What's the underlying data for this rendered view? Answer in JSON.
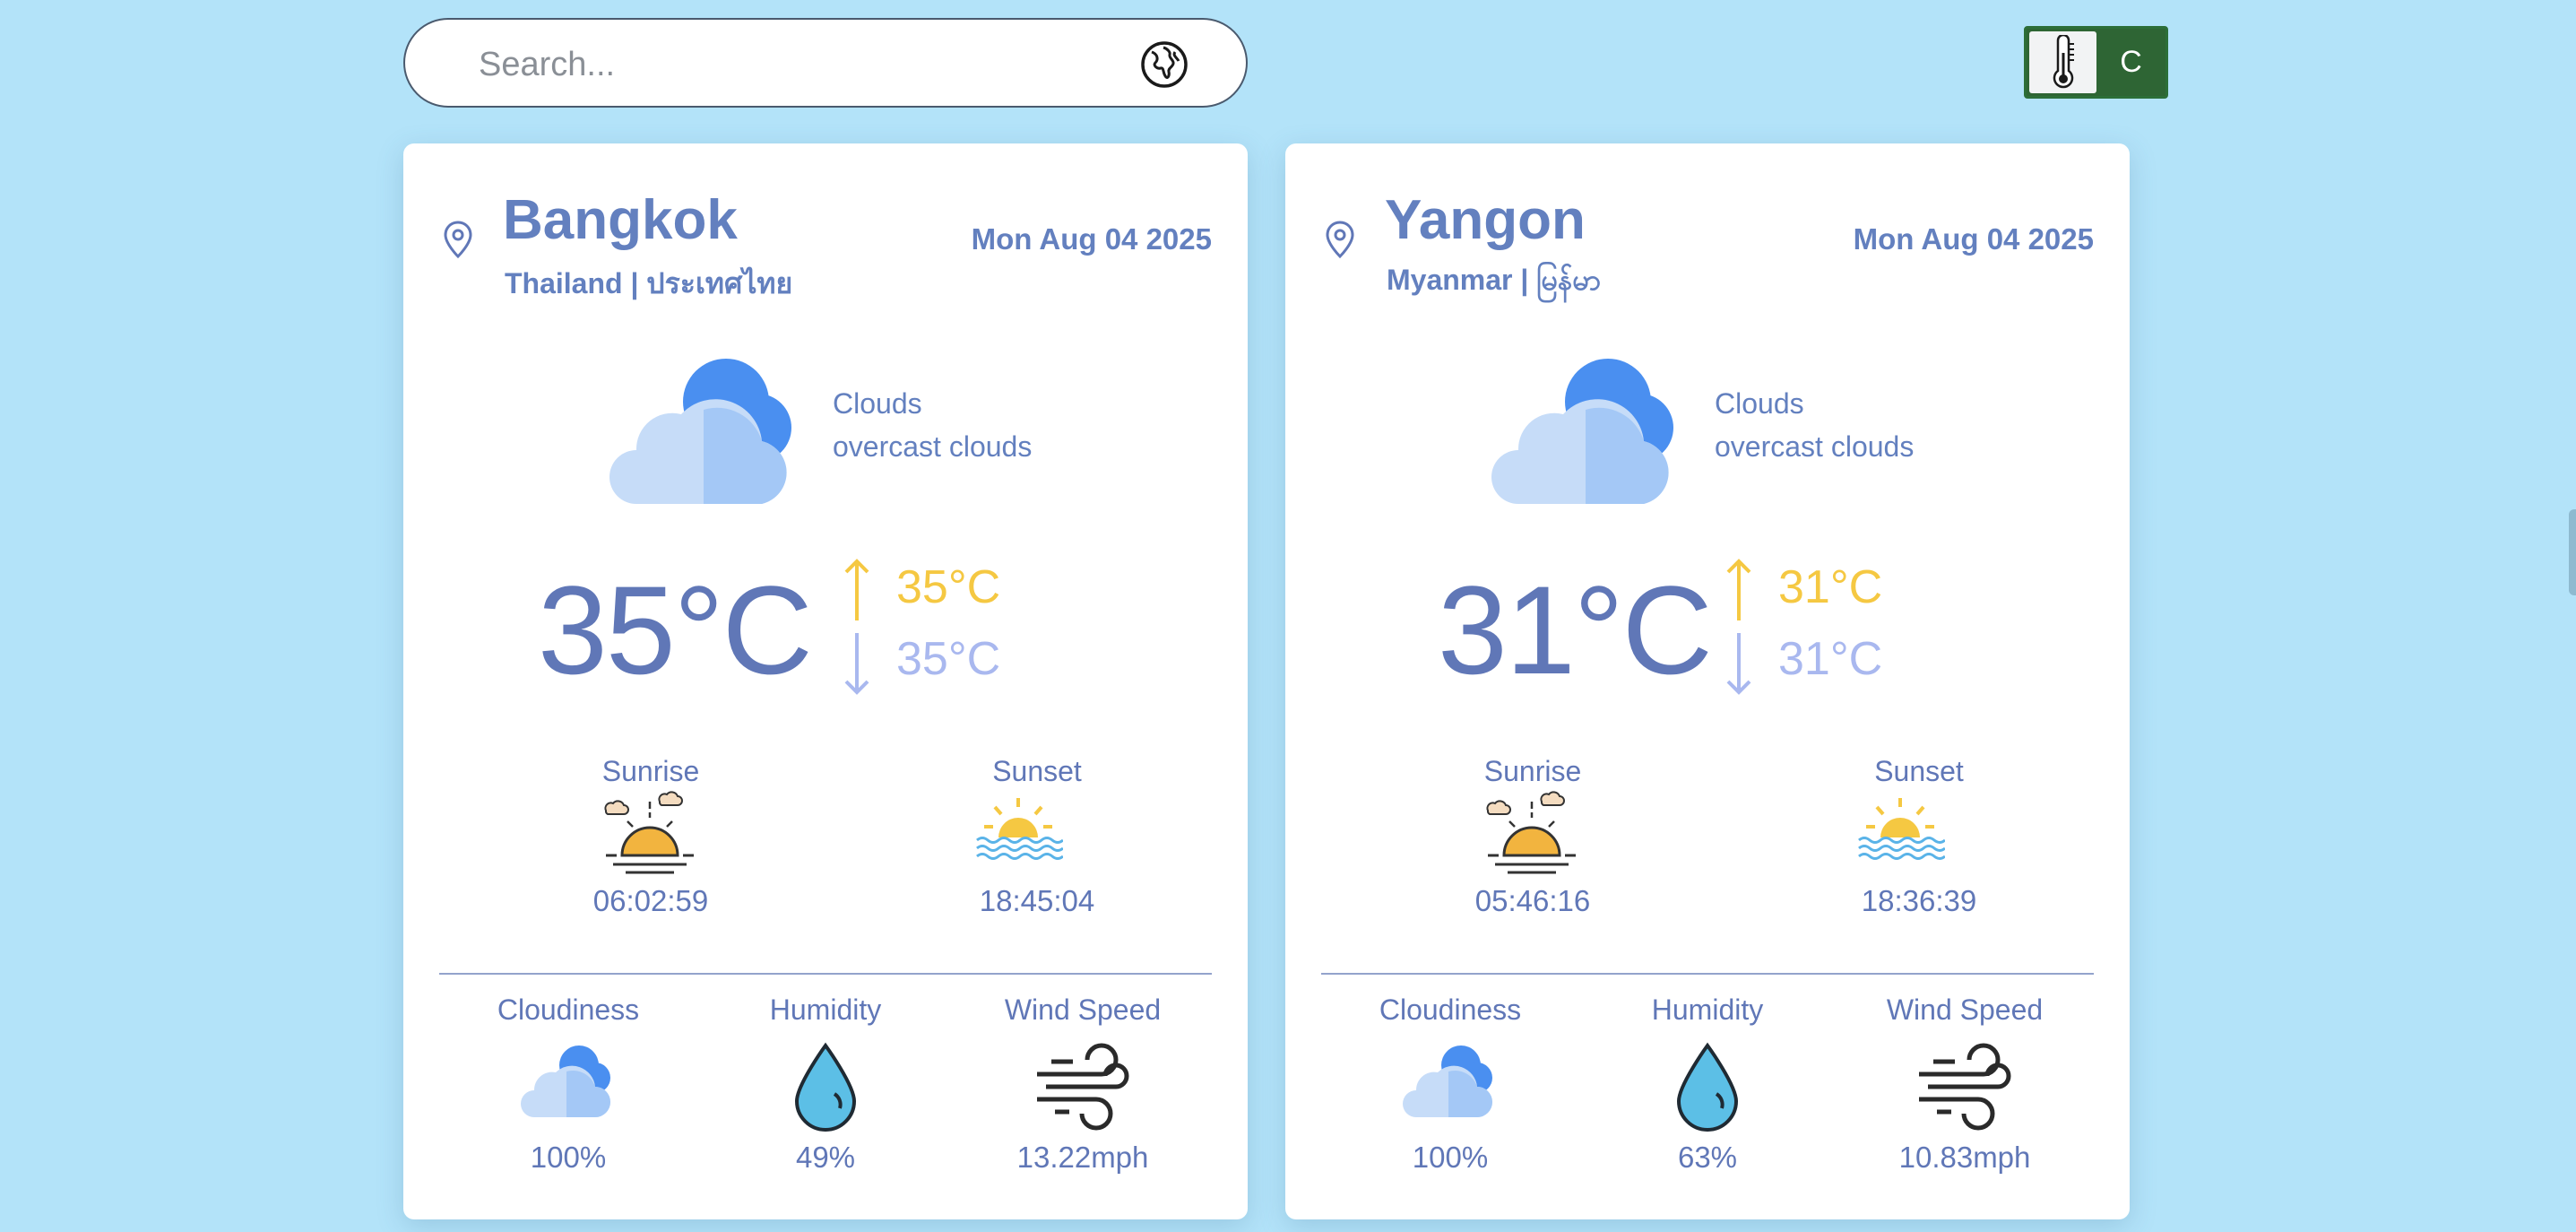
{
  "search": {
    "placeholder": "Search..."
  },
  "icons": {
    "globe": "globe-icon",
    "thermometer": "thermometer-icon",
    "location": "location-pin-icon",
    "clouds": "clouds-icon",
    "sunrise": "sunrise-icon",
    "sunset": "sunset-icon",
    "humidity": "water-drop-icon",
    "wind": "wind-icon"
  },
  "unit_toggle": {
    "value": "C"
  },
  "colors": {
    "background": "#b3e3f9",
    "text": "#6077b7",
    "temp_max": "#f5c842",
    "temp_min": "#a9b8ef",
    "toggle": "#2e6534"
  },
  "cards": [
    {
      "city": "Bangkok",
      "country": "Thailand | ประเทศไทย",
      "date": "Mon Aug 04 2025",
      "condition": "Clouds",
      "description": "overcast clouds",
      "temp": "35°C",
      "temp_max": "35°C",
      "temp_min": "35°C",
      "sunrise_label": "Sunrise",
      "sunrise": "06:02:59",
      "sunset_label": "Sunset",
      "sunset": "18:45:04",
      "cloudiness_label": "Cloudiness",
      "cloudiness": "100%",
      "humidity_label": "Humidity",
      "humidity": "49%",
      "wind_label": "Wind Speed",
      "wind": "13.22mph"
    },
    {
      "city": "Yangon",
      "country": "Myanmar | မြန်မာ",
      "date": "Mon Aug 04 2025",
      "condition": "Clouds",
      "description": "overcast clouds",
      "temp": "31°C",
      "temp_max": "31°C",
      "temp_min": "31°C",
      "sunrise_label": "Sunrise",
      "sunrise": "05:46:16",
      "sunset_label": "Sunset",
      "sunset": "18:36:39",
      "cloudiness_label": "Cloudiness",
      "cloudiness": "100%",
      "humidity_label": "Humidity",
      "humidity": "63%",
      "wind_label": "Wind Speed",
      "wind": "10.83mph"
    }
  ]
}
